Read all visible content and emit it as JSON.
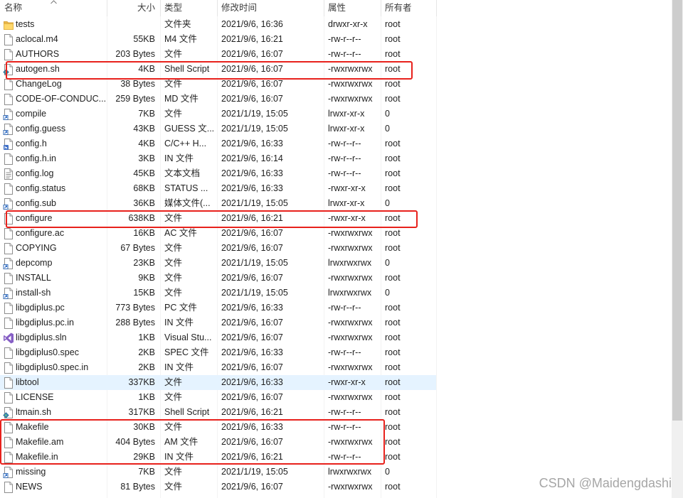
{
  "header": {
    "sort_icon": "sort-ascending-icon",
    "columns": {
      "name": "名称",
      "size": "大小",
      "type": "类型",
      "modified": "修改时间",
      "attributes": "属性",
      "owner": "所有者"
    }
  },
  "file_list": {
    "rows": [
      {
        "icon": "folder-icon",
        "name": "tests",
        "size": "",
        "type": "文件夹",
        "modified": "2021/9/6, 16:36",
        "attributes": "drwxr-xr-x",
        "owner": "root"
      },
      {
        "icon": "file-icon",
        "name": "aclocal.m4",
        "size": "55KB",
        "type": "M4 文件",
        "modified": "2021/9/6, 16:21",
        "attributes": "-rw-r--r--",
        "owner": "root"
      },
      {
        "icon": "file-icon",
        "name": "AUTHORS",
        "size": "203 Bytes",
        "type": "文件",
        "modified": "2021/9/6, 16:07",
        "attributes": "-rw-r--r--",
        "owner": "root"
      },
      {
        "icon": "shell-script-icon",
        "name": "autogen.sh",
        "size": "4KB",
        "type": "Shell Script",
        "modified": "2021/9/6, 16:07",
        "attributes": "-rwxrwxrwx",
        "owner": "root"
      },
      {
        "icon": "file-icon",
        "name": "ChangeLog",
        "size": "38 Bytes",
        "type": "文件",
        "modified": "2021/9/6, 16:07",
        "attributes": "-rwxrwxrwx",
        "owner": "root"
      },
      {
        "icon": "file-icon",
        "name": "CODE-OF-CONDUC...",
        "size": "259 Bytes",
        "type": "MD 文件",
        "modified": "2021/9/6, 16:07",
        "attributes": "-rwxrwxrwx",
        "owner": "root"
      },
      {
        "icon": "symlink-file-icon",
        "name": "compile",
        "size": "7KB",
        "type": "文件",
        "modified": "2021/1/19, 15:05",
        "attributes": "lrwxr-xr-x",
        "owner": "0"
      },
      {
        "icon": "symlink-file-icon",
        "name": "config.guess",
        "size": "43KB",
        "type": "GUESS 文...",
        "modified": "2021/1/19, 15:05",
        "attributes": "lrwxr-xr-x",
        "owner": "0"
      },
      {
        "icon": "c-header-icon",
        "name": "config.h",
        "size": "4KB",
        "type": "C/C++ H...",
        "modified": "2021/9/6, 16:33",
        "attributes": "-rw-r--r--",
        "owner": "root"
      },
      {
        "icon": "file-icon",
        "name": "config.h.in",
        "size": "3KB",
        "type": "IN 文件",
        "modified": "2021/9/6, 16:14",
        "attributes": "-rw-r--r--",
        "owner": "root"
      },
      {
        "icon": "text-document-icon",
        "name": "config.log",
        "size": "45KB",
        "type": "文本文档",
        "modified": "2021/9/6, 16:33",
        "attributes": "-rw-r--r--",
        "owner": "root"
      },
      {
        "icon": "file-icon",
        "name": "config.status",
        "size": "68KB",
        "type": "STATUS ...",
        "modified": "2021/9/6, 16:33",
        "attributes": "-rwxr-xr-x",
        "owner": "root"
      },
      {
        "icon": "symlink-file-icon",
        "name": "config.sub",
        "size": "36KB",
        "type": "媒体文件(...",
        "modified": "2021/1/19, 15:05",
        "attributes": "lrwxr-xr-x",
        "owner": "0"
      },
      {
        "icon": "file-icon",
        "name": "configure",
        "size": "638KB",
        "type": "文件",
        "modified": "2021/9/6, 16:21",
        "attributes": "-rwxr-xr-x",
        "owner": "root"
      },
      {
        "icon": "file-icon",
        "name": "configure.ac",
        "size": "16KB",
        "type": "AC 文件",
        "modified": "2021/9/6, 16:07",
        "attributes": "-rwxrwxrwx",
        "owner": "root"
      },
      {
        "icon": "file-icon",
        "name": "COPYING",
        "size": "67 Bytes",
        "type": "文件",
        "modified": "2021/9/6, 16:07",
        "attributes": "-rwxrwxrwx",
        "owner": "root"
      },
      {
        "icon": "symlink-file-icon",
        "name": "depcomp",
        "size": "23KB",
        "type": "文件",
        "modified": "2021/1/19, 15:05",
        "attributes": "lrwxrwxrwx",
        "owner": "0"
      },
      {
        "icon": "file-icon",
        "name": "INSTALL",
        "size": "9KB",
        "type": "文件",
        "modified": "2021/9/6, 16:07",
        "attributes": "-rwxrwxrwx",
        "owner": "root"
      },
      {
        "icon": "symlink-file-icon",
        "name": "install-sh",
        "size": "15KB",
        "type": "文件",
        "modified": "2021/1/19, 15:05",
        "attributes": "lrwxrwxrwx",
        "owner": "0"
      },
      {
        "icon": "file-icon",
        "name": "libgdiplus.pc",
        "size": "773 Bytes",
        "type": "PC 文件",
        "modified": "2021/9/6, 16:33",
        "attributes": "-rw-r--r--",
        "owner": "root"
      },
      {
        "icon": "file-icon",
        "name": "libgdiplus.pc.in",
        "size": "288 Bytes",
        "type": "IN 文件",
        "modified": "2021/9/6, 16:07",
        "attributes": "-rwxrwxrwx",
        "owner": "root"
      },
      {
        "icon": "visual-studio-solution-icon",
        "name": "libgdiplus.sln",
        "size": "1KB",
        "type": "Visual Stu...",
        "modified": "2021/9/6, 16:07",
        "attributes": "-rwxrwxrwx",
        "owner": "root"
      },
      {
        "icon": "file-icon",
        "name": "libgdiplus0.spec",
        "size": "2KB",
        "type": "SPEC 文件",
        "modified": "2021/9/6, 16:33",
        "attributes": "-rw-r--r--",
        "owner": "root"
      },
      {
        "icon": "file-icon",
        "name": "libgdiplus0.spec.in",
        "size": "2KB",
        "type": "IN 文件",
        "modified": "2021/9/6, 16:07",
        "attributes": "-rwxrwxrwx",
        "owner": "root"
      },
      {
        "icon": "file-icon",
        "name": "libtool",
        "size": "337KB",
        "type": "文件",
        "modified": "2021/9/6, 16:33",
        "attributes": "-rwxr-xr-x",
        "owner": "root",
        "hovered": true
      },
      {
        "icon": "file-icon",
        "name": "LICENSE",
        "size": "1KB",
        "type": "文件",
        "modified": "2021/9/6, 16:07",
        "attributes": "-rwxrwxrwx",
        "owner": "root"
      },
      {
        "icon": "shell-script-icon",
        "name": "ltmain.sh",
        "size": "317KB",
        "type": "Shell Script",
        "modified": "2021/9/6, 16:21",
        "attributes": "-rw-r--r--",
        "owner": "root"
      },
      {
        "icon": "file-icon",
        "name": "Makefile",
        "size": "30KB",
        "type": "文件",
        "modified": "2021/9/6, 16:33",
        "attributes": "-rw-r--r--",
        "owner": "root"
      },
      {
        "icon": "file-icon",
        "name": "Makefile.am",
        "size": "404 Bytes",
        "type": "AM 文件",
        "modified": "2021/9/6, 16:07",
        "attributes": "-rwxrwxrwx",
        "owner": "root"
      },
      {
        "icon": "file-icon",
        "name": "Makefile.in",
        "size": "29KB",
        "type": "IN 文件",
        "modified": "2021/9/6, 16:21",
        "attributes": "-rw-r--r--",
        "owner": "root"
      },
      {
        "icon": "symlink-file-icon",
        "name": "missing",
        "size": "7KB",
        "type": "文件",
        "modified": "2021/1/19, 15:05",
        "attributes": "lrwxrwxrwx",
        "owner": "0"
      },
      {
        "icon": "file-icon",
        "name": "NEWS",
        "size": "81 Bytes",
        "type": "文件",
        "modified": "2021/9/6, 16:07",
        "attributes": "-rwxrwxrwx",
        "owner": "root"
      }
    ]
  },
  "watermark": "CSDN @Maidengdashi",
  "colors": {
    "hover_row_background": "#e5f3ff",
    "annotation_box": "#e8211c",
    "watermark_text": "#a6a6a6"
  }
}
